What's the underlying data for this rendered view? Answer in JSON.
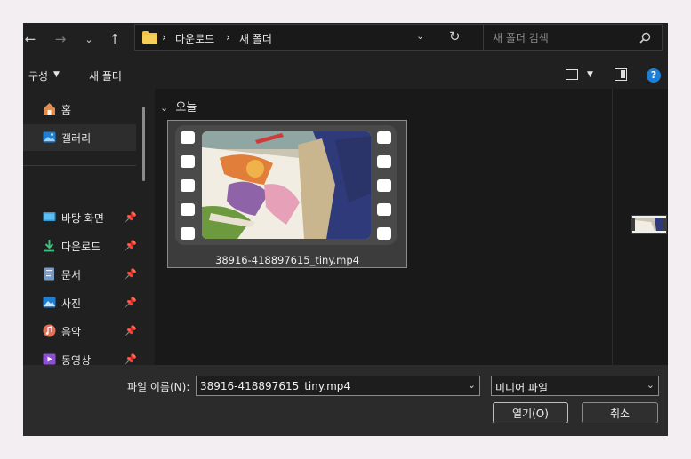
{
  "address_bar": {
    "breadcrumbs": [
      "다운로드",
      "새 폴더"
    ],
    "search_placeholder": "새 폴더 검색"
  },
  "toolbar": {
    "organize_label": "구성",
    "new_folder_label": "새 폴더"
  },
  "sidebar": {
    "quick": [
      {
        "label": "홈",
        "icon": "home-icon"
      },
      {
        "label": "갤러리",
        "icon": "gallery-icon"
      }
    ],
    "pinned": [
      {
        "label": "바탕 화면",
        "icon": "desktop-icon"
      },
      {
        "label": "다운로드",
        "icon": "download-icon"
      },
      {
        "label": "문서",
        "icon": "document-icon"
      },
      {
        "label": "사진",
        "icon": "pictures-icon"
      },
      {
        "label": "음악",
        "icon": "music-icon"
      },
      {
        "label": "동영상",
        "icon": "videos-icon"
      }
    ]
  },
  "content": {
    "group_header": "오늘",
    "files": [
      {
        "name": "38916-418897615_tiny.mp4",
        "type": "video"
      }
    ]
  },
  "footer": {
    "filename_label": "파일 이름(N):",
    "filename_value": "38916-418897615_tiny.mp4",
    "filetype_value": "미디어 파일",
    "open_label": "열기(O)",
    "cancel_label": "취소"
  },
  "colors": {
    "background": "#202020",
    "content_bg": "#191919",
    "footer_bg": "#2b2b2b",
    "accent_blue": "#1b7fd6",
    "folder_yellow": "#f3c442"
  }
}
